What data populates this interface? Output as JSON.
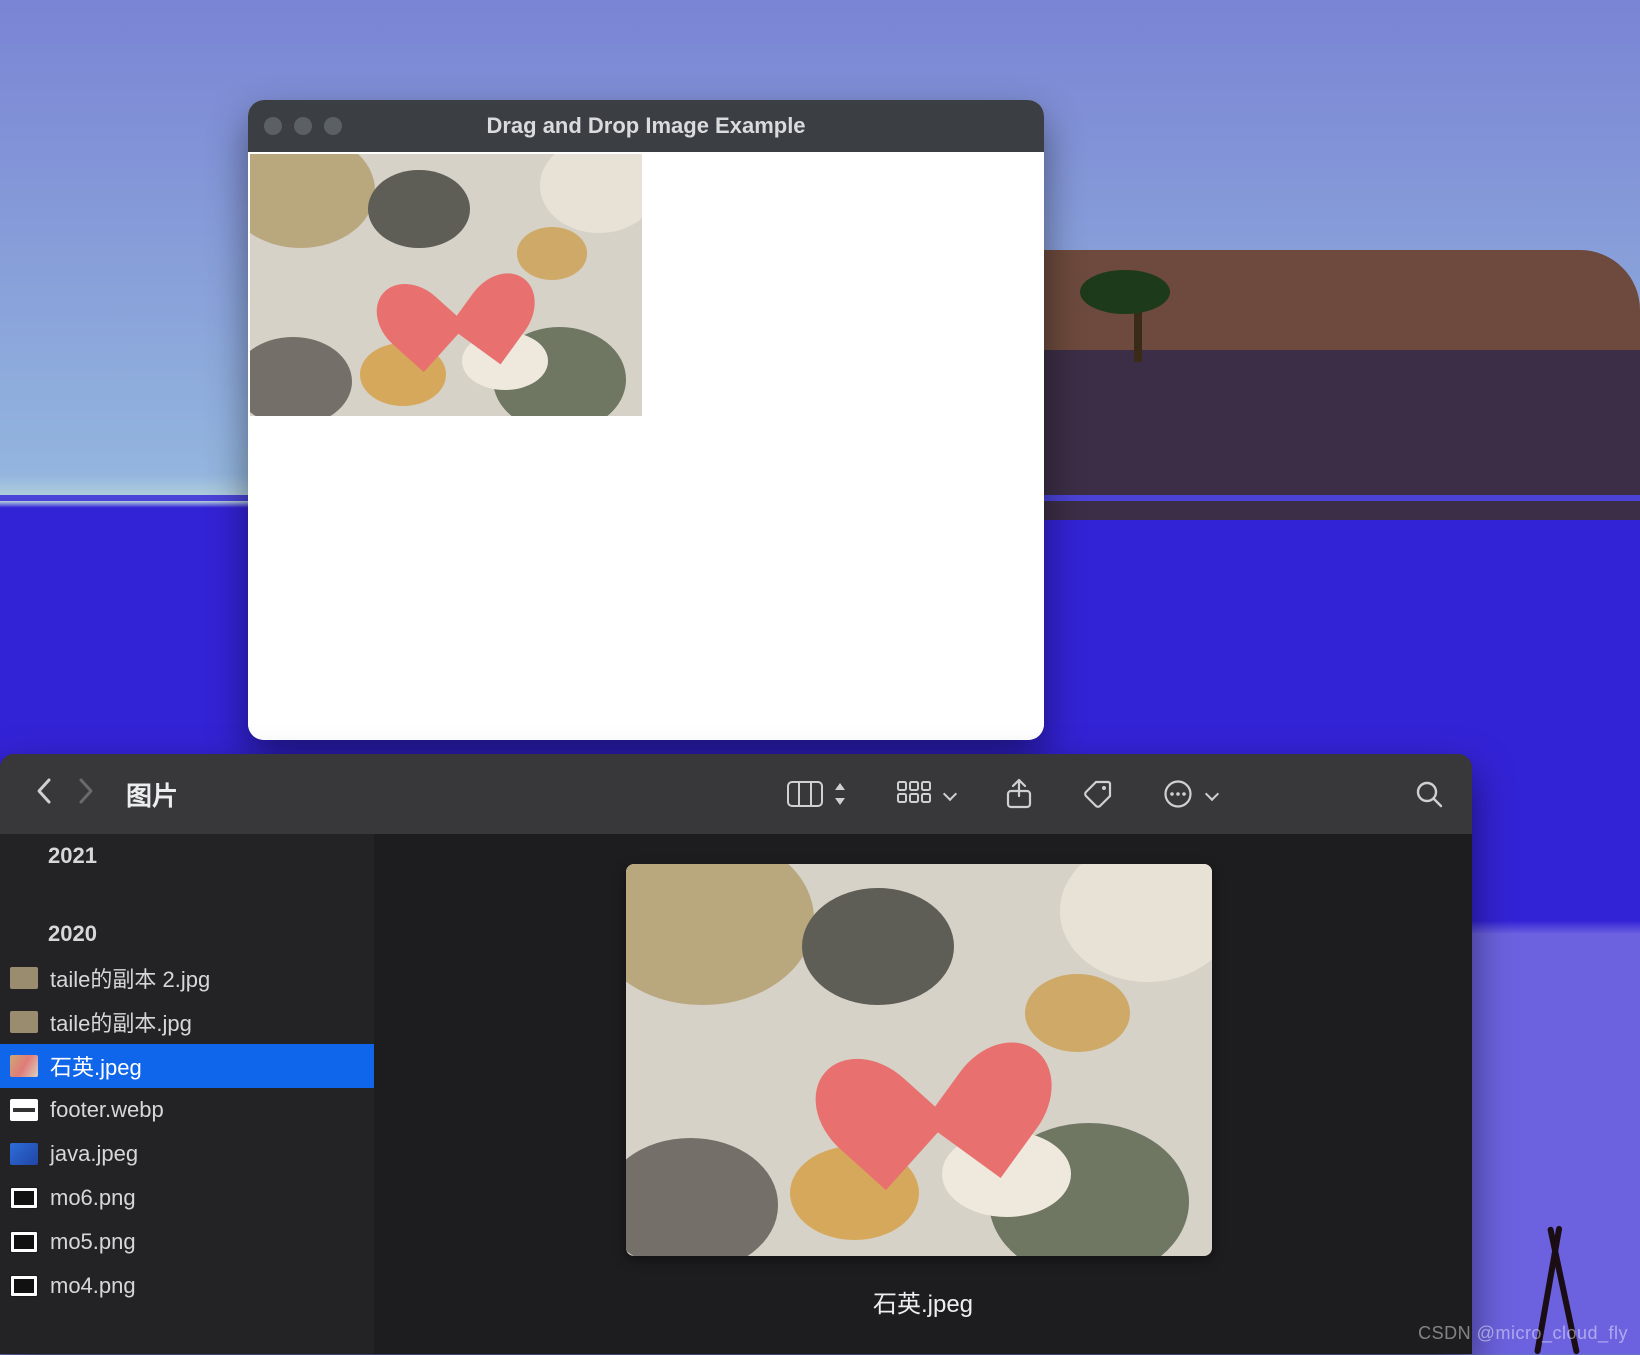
{
  "app": {
    "title": "Drag and Drop Image Example",
    "traffic_icons": [
      "close-icon",
      "minimize-icon",
      "zoom-icon"
    ]
  },
  "finder": {
    "title": "图片",
    "toolbar_icons": [
      "columns-view-icon",
      "grid-view-icon",
      "share-icon",
      "tags-icon",
      "more-icon",
      "search-icon"
    ],
    "sidebar": {
      "years": [
        "2021",
        "2020"
      ],
      "files": [
        {
          "name": "taile的副本 2.jpg",
          "thumb": "photo"
        },
        {
          "name": "taile的副本.jpg",
          "thumb": "photo"
        },
        {
          "name": "石英.jpeg",
          "thumb": "sel",
          "selected": true
        },
        {
          "name": "footer.webp",
          "thumb": "web"
        },
        {
          "name": "java.jpeg",
          "thumb": "java"
        },
        {
          "name": "mo6.png",
          "thumb": "mo"
        },
        {
          "name": "mo5.png",
          "thumb": "mo"
        },
        {
          "name": "mo4.png",
          "thumb": "mo"
        }
      ]
    },
    "preview_name": "石英.jpeg"
  },
  "watermark": "CSDN @micro_cloud_fly"
}
